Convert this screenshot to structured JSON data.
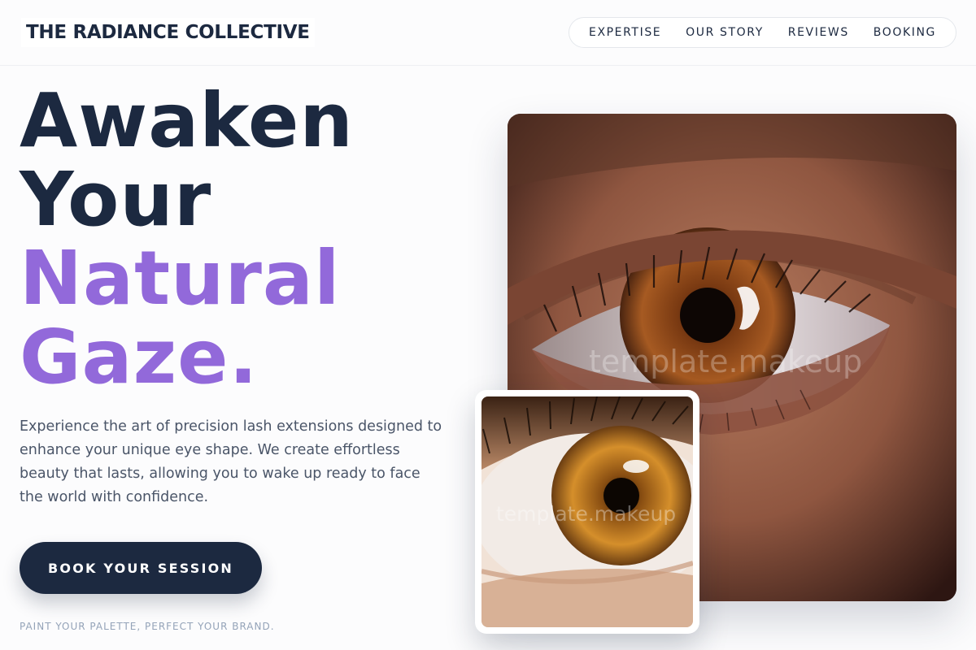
{
  "brand": {
    "name": "THE RADIANCE COLLECTIVE"
  },
  "nav": {
    "items": [
      {
        "label": "EXPERTISE"
      },
      {
        "label": "OUR STORY"
      },
      {
        "label": "REVIEWS"
      },
      {
        "label": "BOOKING"
      }
    ]
  },
  "hero": {
    "headline_line1": "Awaken",
    "headline_line2": "Your",
    "headline_line3": "Natural",
    "headline_line4": "Gaze.",
    "intro": "Experience the art of precision lash extensions designed to enhance your unique eye shape. We create effortless beauty that lasts, allowing you to wake up ready to face the world with confidence.",
    "cta_label": "BOOK YOUR SESSION",
    "tagline": "PAINT YOUR PALETTE, PERFECT YOUR BRAND."
  },
  "images": {
    "main_watermark": "template.makeup",
    "inset_watermark": "template.makeup"
  },
  "colors": {
    "navy": "#1c2940",
    "accent_purple": "#9269da",
    "muted_text": "#4a5568",
    "tagline": "#94a3b8"
  }
}
